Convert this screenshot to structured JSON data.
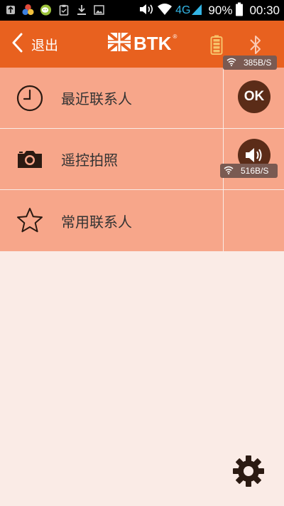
{
  "status_bar": {
    "network_type": "4G",
    "battery_percent": "90%",
    "time": "00:30",
    "left_icons": [
      "usb-icon",
      "color-balls-icon",
      "wechat-icon",
      "clipboard-icon",
      "download-icon",
      "image-icon"
    ],
    "right_icons": [
      "volume-icon",
      "wifi-icon",
      "signal-icon",
      "battery-icon"
    ]
  },
  "header": {
    "back_label": "退出",
    "logo_text": "BTK",
    "logo_reg": "®",
    "accent_color": "#e8611f"
  },
  "speed_badges": [
    {
      "value": "385B/S"
    },
    {
      "value": "516B/S"
    }
  ],
  "menu": {
    "items": [
      {
        "label": "最近联系人",
        "icon": "clock-icon"
      },
      {
        "label": "遥控拍照",
        "icon": "camera-icon"
      },
      {
        "label": "常用联系人",
        "icon": "star-icon"
      }
    ],
    "ok_label": "OK"
  }
}
